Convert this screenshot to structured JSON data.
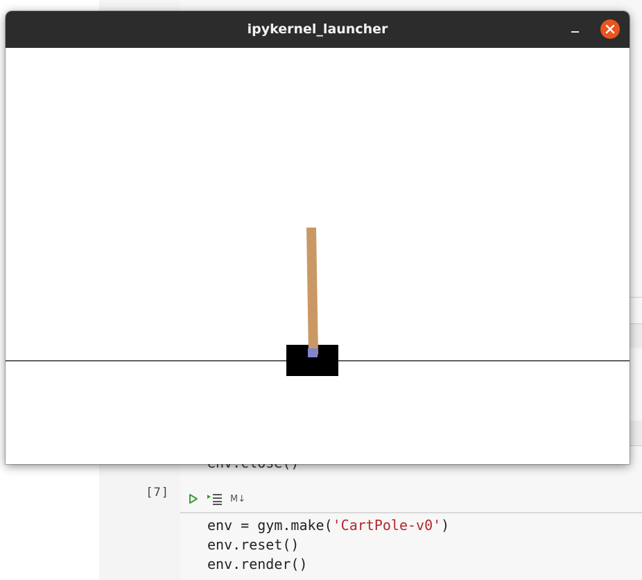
{
  "window": {
    "title": "ipykernel_launcher",
    "minimize_icon": "minimize-icon",
    "close_icon": "close-icon",
    "close_color": "#e95420"
  },
  "render": {
    "cart_color": "#000000",
    "pole_color": "#ca9865",
    "axle_color": "#8184cb",
    "track_color": "#000000"
  },
  "notebook": {
    "cell_prompt": "[7]",
    "toolbar": {
      "run_icon": "run-cell-icon",
      "run_all_icon": "run-all-below-icon",
      "markdown_label": "M↓"
    },
    "partial_code_line": "env.close()",
    "code_lines": [
      {
        "pre": "env = gym.make(",
        "str": "'CartPole-v0'",
        "post": ")"
      },
      {
        "pre": "env.reset()",
        "str": "",
        "post": ""
      },
      {
        "pre": "env.render()",
        "str": "",
        "post": ""
      }
    ]
  }
}
